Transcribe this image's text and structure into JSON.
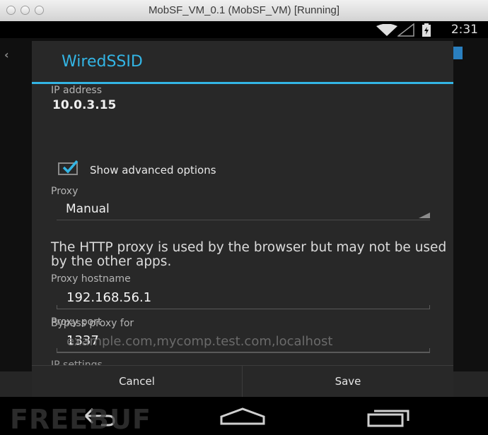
{
  "window": {
    "title": "MobSF_VM_0.1 (MobSF_VM) [Running]"
  },
  "status_bar": {
    "time": "2:31"
  },
  "dialog": {
    "title": "WiredSSID",
    "ip_address_label": "IP address",
    "ip_address_value": "10.0.3.15",
    "show_advanced_label": "Show advanced options",
    "show_advanced_checked": true,
    "proxy_label": "Proxy",
    "proxy_selected": "Manual",
    "proxy_info": "The HTTP proxy is used by the browser but may not be used by the other apps.",
    "hostname_label": "Proxy hostname",
    "hostname_value": "192.168.56.1",
    "port_label": "Proxy port",
    "port_value": "1337",
    "bypass_label": "Bypass proxy for",
    "bypass_placeholder": "example.com,mycomp.test.com,localhost",
    "ip_settings_label": "IP settings",
    "cancel_label": "Cancel",
    "save_label": "Save"
  },
  "watermark": {
    "text": "FREEBUF"
  },
  "colors": {
    "accent": "#33b5e5",
    "dialog_bg": "#282828"
  }
}
